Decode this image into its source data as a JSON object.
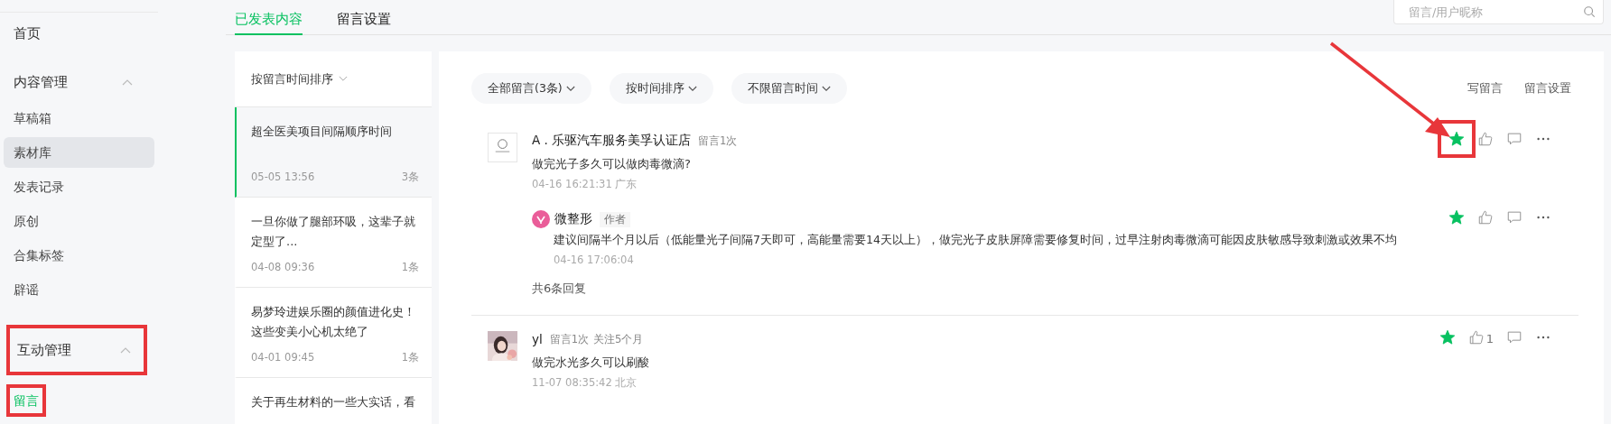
{
  "sidebar": {
    "items": [
      {
        "label": "首页",
        "kind": "top"
      },
      {
        "label": "内容管理",
        "kind": "group",
        "expanded": true,
        "highlighted": false,
        "children": [
          {
            "label": "草稿箱",
            "selected": false,
            "hovered": false,
            "highlighted": false
          },
          {
            "label": "素材库",
            "selected": false,
            "hovered": true,
            "highlighted": false
          },
          {
            "label": "发表记录",
            "selected": false,
            "hovered": false,
            "highlighted": false
          },
          {
            "label": "原创",
            "selected": false,
            "hovered": false,
            "highlighted": false
          },
          {
            "label": "合集标签",
            "selected": false,
            "hovered": false,
            "highlighted": false
          },
          {
            "label": "辟谣",
            "selected": false,
            "hovered": false,
            "highlighted": false
          }
        ]
      },
      {
        "label": "互动管理",
        "kind": "group",
        "expanded": true,
        "highlighted": true,
        "children": [
          {
            "label": "留言",
            "selected": true,
            "hovered": false,
            "highlighted": true
          }
        ]
      }
    ]
  },
  "tabs": [
    {
      "label": "已发表内容",
      "selected": true
    },
    {
      "label": "留言设置",
      "selected": false
    }
  ],
  "search": {
    "placeholder": "留言/用户昵称"
  },
  "articles": {
    "sort": "按留言时间排序",
    "items": [
      {
        "title": "超全医美项目间隔顺序时间",
        "time": "05-05 13:56",
        "count": "3条",
        "selected": true
      },
      {
        "title": "一旦你做了腿部环吸，这辈子就定型了...",
        "time": "04-08 09:36",
        "count": "1条",
        "selected": false
      },
      {
        "title": "易梦玲进娱乐圈的颜值进化史！这些变美小心机太绝了",
        "time": "04-01 09:45",
        "count": "1条",
        "selected": false
      },
      {
        "title": "关于再生材料的一些大实话，看",
        "selected": false
      }
    ]
  },
  "filters": [
    "全部留言(3条)",
    "按时间排序",
    "不限留言时间"
  ],
  "links": [
    "写留言",
    "留言设置"
  ],
  "comments": [
    {
      "avatar": {
        "kind": "logo"
      },
      "author": "A . 乐驱汽车服务美孚认证店",
      "meta": [
        "留言1次"
      ],
      "text": "做完光子多久可以做肉毒微滴?",
      "time": "04-16 16:21:31 广东",
      "starred": true,
      "highlighted": true,
      "replies": [
        {
          "author": "微整形",
          "tag": "作者",
          "text": "建议间隔半个月以后（低能量光子间隔7天即可，高能量需要14天以上），做完光子皮肤屏障需要修复时间，过早注射肉毒微滴可能因皮肤敏感导致刺激或效果不均",
          "time": "04-16 17:06:04",
          "starred": true
        }
      ],
      "reply_count": "共6条回复"
    },
    {
      "avatar": {
        "kind": "picture"
      },
      "author": "yl",
      "meta": [
        "留言1次",
        "关注5个月"
      ],
      "text": "做完水光多久可以刷酸",
      "time": "11-07 08:35:42 北京",
      "starred": true,
      "highlighted": false,
      "likes": "1"
    }
  ],
  "annotation": {
    "arrow": true
  }
}
